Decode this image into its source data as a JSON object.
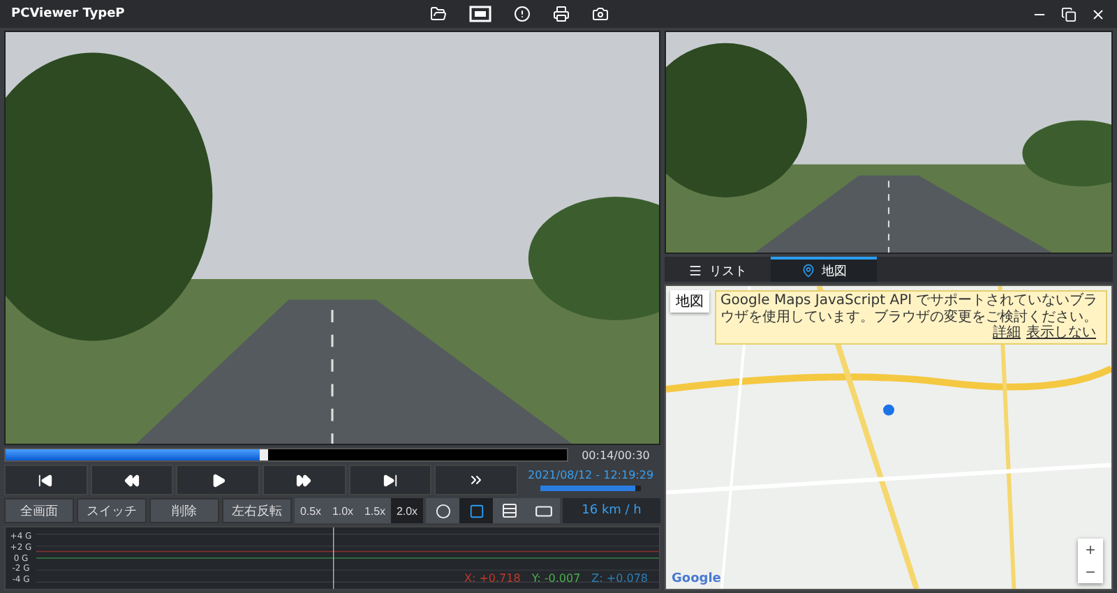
{
  "window": {
    "title": "PCViewer TypeP"
  },
  "player": {
    "progress": {
      "level": 0.46,
      "time": "00:14/00:30"
    },
    "timestamp": "2021/08/12 - 12:19:29",
    "volume": {
      "level": 0.95
    },
    "buttons": [
      "全画面",
      "スイッチ",
      "削除",
      "左右反転"
    ],
    "speeds": [
      {
        "label": "0.5x",
        "selected": false
      },
      {
        "label": "1.0x",
        "selected": false
      },
      {
        "label": "1.5x",
        "selected": false
      },
      {
        "label": "2.0x",
        "selected": true
      }
    ],
    "layouts": [
      {
        "kind": "circle",
        "selected": false
      },
      {
        "kind": "single",
        "selected": true
      },
      {
        "kind": "split",
        "selected": false
      },
      {
        "kind": "wide",
        "selected": false
      }
    ],
    "speed_reading": "16 km / h"
  },
  "gsensor": {
    "ticks": [
      "+4 G",
      "+2 G",
      "0 G",
      "-2 G",
      "-4 G"
    ],
    "readings": [
      {
        "text": "X: +0.718",
        "color": "#c0392b"
      },
      {
        "text": "Y: -0.007",
        "color": "#4caf50"
      },
      {
        "text": "Z: +0.078",
        "color": "#2980b9"
      }
    ]
  },
  "tabs": [
    {
      "label": "リスト",
      "selected": false
    },
    {
      "label": "地図",
      "selected": true
    }
  ],
  "map": {
    "type_label": "地図",
    "warning": "Google Maps JavaScript API でサポートされていないブラウザを使用しています。ブラウザの変更をご検討ください。",
    "warning_links": [
      "詳細",
      "表示しない"
    ],
    "zoom": [
      "+",
      "−"
    ],
    "brand": "Google"
  }
}
